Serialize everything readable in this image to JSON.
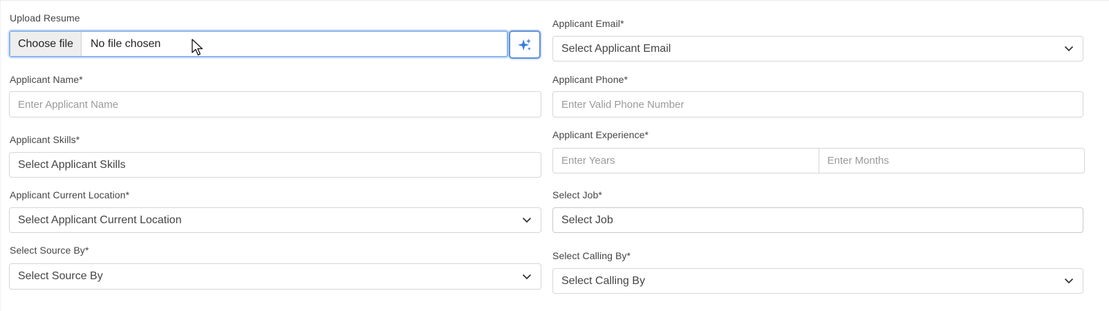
{
  "upload": {
    "label": "Upload Resume",
    "choose_button": "Choose file",
    "status": "No file chosen",
    "ai_icon": "sparkle-icon"
  },
  "email": {
    "label": "Applicant Email*",
    "value": "Select Applicant Email"
  },
  "name": {
    "label": "Applicant Name*",
    "placeholder": "Enter Applicant Name"
  },
  "phone": {
    "label": "Applicant Phone*",
    "placeholder": "Enter Valid Phone Number"
  },
  "skills": {
    "label": "Applicant Skills*",
    "value": "Select Applicant Skills"
  },
  "experience": {
    "label": "Applicant Experience*",
    "years_placeholder": "Enter Years",
    "months_placeholder": "Enter Months"
  },
  "location": {
    "label": "Applicant Current Location*",
    "value": "Select Applicant Current Location"
  },
  "job": {
    "label": "Select Job*",
    "value": "Select Job"
  },
  "source": {
    "label": "Select Source By*",
    "value": "Select Source By"
  },
  "calling": {
    "label": "Select Calling By*",
    "value": "Select Calling By"
  },
  "colors": {
    "focus_border": "#8ab4f0",
    "ai_icon": "#3b7ddd",
    "border": "#d5d5d5"
  }
}
